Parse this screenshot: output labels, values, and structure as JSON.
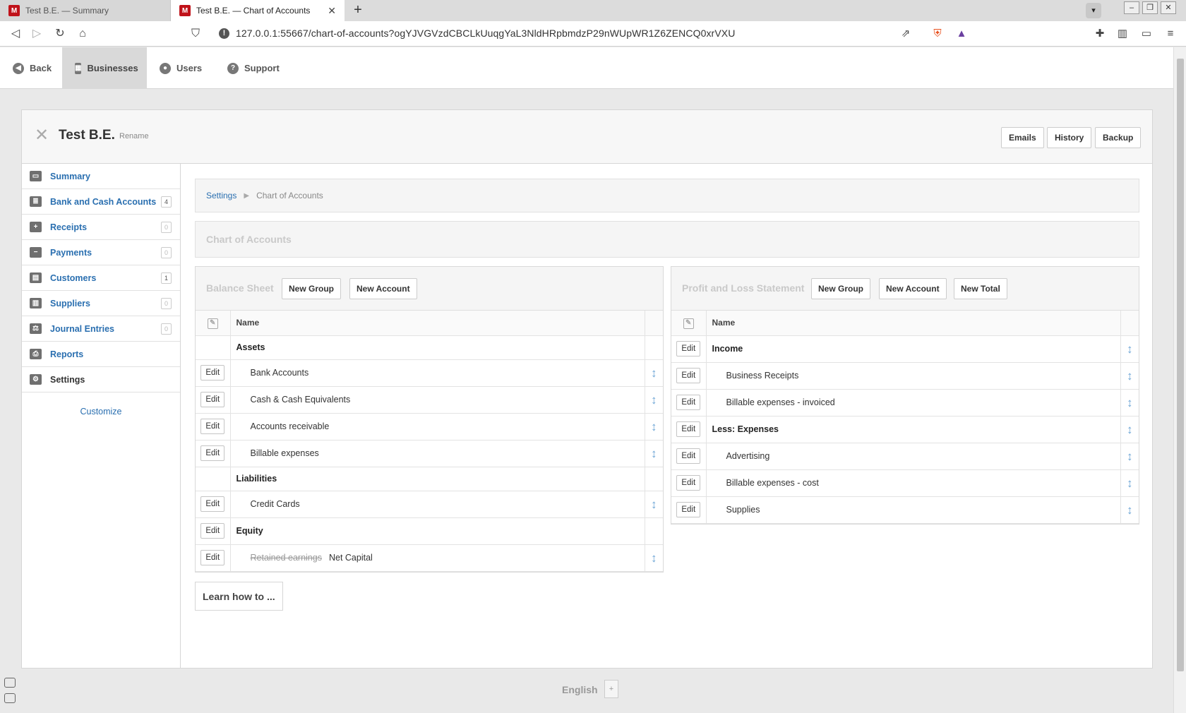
{
  "browser": {
    "tabs": [
      {
        "title": "Test B.E. — Summary",
        "active": false
      },
      {
        "title": "Test B.E. — Chart of Accounts",
        "active": true
      }
    ],
    "url": "127.0.0.1:55667/chart-of-accounts?ogYJVGVzdCBCLkUuqgYaL3NldHRpbmdzP29nWUpWR1Z6ZENCQ0xrVXU"
  },
  "topnav": {
    "back": "Back",
    "businesses": "Businesses",
    "users": "Users",
    "support": "Support"
  },
  "business": {
    "name": "Test B.E.",
    "rename": "Rename",
    "buttons": {
      "emails": "Emails",
      "history": "History",
      "backup": "Backup"
    }
  },
  "sidebar": {
    "items": [
      {
        "label": "Summary",
        "icon": "monitor-icon",
        "badge": null
      },
      {
        "label": "Bank and Cash Accounts",
        "icon": "coins-icon",
        "badge": "4"
      },
      {
        "label": "Receipts",
        "icon": "plus-square-icon",
        "badge": "0"
      },
      {
        "label": "Payments",
        "icon": "minus-square-icon",
        "badge": "0"
      },
      {
        "label": "Customers",
        "icon": "customers-icon",
        "badge": "1"
      },
      {
        "label": "Suppliers",
        "icon": "factory-icon",
        "badge": "0"
      },
      {
        "label": "Journal Entries",
        "icon": "balance-scale-icon",
        "badge": "0"
      },
      {
        "label": "Reports",
        "icon": "printer-icon",
        "badge": null
      },
      {
        "label": "Settings",
        "icon": "gear-icon",
        "badge": null
      }
    ],
    "customize": "Customize"
  },
  "breadcrumb": {
    "parent": "Settings",
    "current": "Chart of Accounts"
  },
  "page_title": "Chart of Accounts",
  "balance_sheet": {
    "title": "Balance Sheet",
    "new_group": "New Group",
    "new_account": "New Account",
    "col_name": "Name",
    "edit_label": "Edit",
    "rows": [
      {
        "type": "group",
        "name": "Assets",
        "editable": false,
        "movable": false
      },
      {
        "type": "account",
        "name": "Bank Accounts",
        "editable": true,
        "movable": true
      },
      {
        "type": "account",
        "name": "Cash & Cash Equivalents",
        "editable": true,
        "movable": true
      },
      {
        "type": "account",
        "name": "Accounts receivable",
        "editable": true,
        "movable": true
      },
      {
        "type": "account",
        "name": "Billable expenses",
        "editable": true,
        "movable": true
      },
      {
        "type": "group",
        "name": "Liabilities",
        "editable": false,
        "movable": false
      },
      {
        "type": "account",
        "name": "Credit Cards",
        "editable": true,
        "movable": true
      },
      {
        "type": "group",
        "name": "Equity",
        "editable": true,
        "movable": false
      },
      {
        "type": "account",
        "name": "Net Capital",
        "struck_name": "Retained earnings",
        "editable": true,
        "movable": true
      }
    ]
  },
  "profit_loss": {
    "title": "Profit and Loss Statement",
    "new_group": "New Group",
    "new_account": "New Account",
    "new_total": "New Total",
    "col_name": "Name",
    "edit_label": "Edit",
    "rows": [
      {
        "type": "group",
        "name": "Income"
      },
      {
        "type": "account",
        "name": "Business Receipts"
      },
      {
        "type": "account",
        "name": "Billable expenses - invoiced"
      },
      {
        "type": "group",
        "name": "Less: Expenses"
      },
      {
        "type": "account",
        "name": "Advertising"
      },
      {
        "type": "account",
        "name": "Billable expenses - cost"
      },
      {
        "type": "account",
        "name": "Supplies"
      }
    ]
  },
  "learn_how": "Learn how to ...",
  "footer": {
    "language": "English",
    "language_add": "+"
  },
  "colors": {
    "link": "#2a6fb0",
    "mover": "#6fa7d6",
    "muted_title": "#c9c9c9"
  }
}
